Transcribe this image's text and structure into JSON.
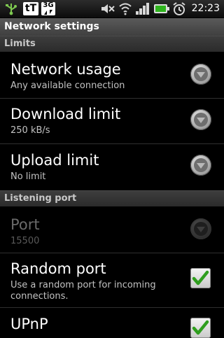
{
  "status_bar": {
    "icons": [
      "usb-debug-icon",
      "text-app-icon",
      "3g-signal-icon",
      "sound-muted-icon",
      "wifi-icon",
      "signal-bars-icon",
      "battery-icon",
      "alarm-icon"
    ],
    "text_app_label": "tT",
    "network_type": "3G",
    "time": "22:23"
  },
  "title_bar": {
    "title": "Network settings"
  },
  "sections": {
    "limits": {
      "label": "Limits",
      "items": [
        {
          "title": "Network usage",
          "summary": "Any available connection"
        },
        {
          "title": "Download limit",
          "summary": "250 kB/s"
        },
        {
          "title": "Upload limit",
          "summary": "No limit"
        }
      ]
    },
    "listening_port": {
      "label": "Listening port",
      "items": [
        {
          "title": "Port",
          "summary": "15500",
          "enabled": false
        },
        {
          "title": "Random port",
          "summary": "Use a random port for incoming connections.",
          "checked": true
        },
        {
          "title": "UPnP",
          "checked": true
        }
      ]
    }
  },
  "colors": {
    "background": "#000000",
    "check_green": "#2f9e1e",
    "category_text": "#c8c8c8"
  }
}
